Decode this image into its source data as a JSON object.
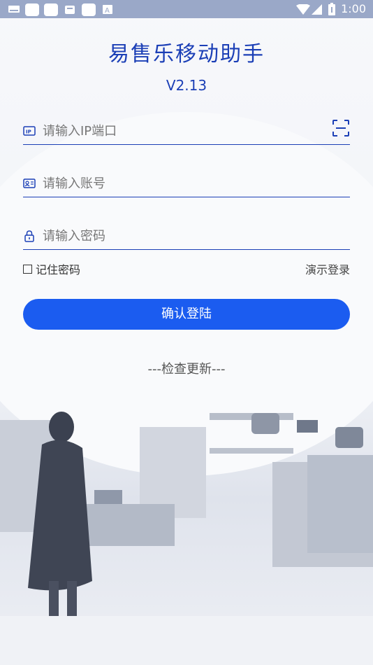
{
  "status_bar": {
    "time": "1:00",
    "icons": [
      "keyboard-icon",
      "app-icon",
      "app-icon",
      "app-icon",
      "app-icon",
      "font-icon",
      "wifi-icon",
      "signal-icon",
      "battery-icon"
    ]
  },
  "header": {
    "title": "易售乐移动助手",
    "version": "V2.13"
  },
  "form": {
    "ip_placeholder": "请输入IP端口",
    "ip_value": "",
    "account_placeholder": "请输入账号",
    "account_value": "",
    "password_placeholder": "请输入密码",
    "password_value": "",
    "remember_label": "记住密码",
    "remember_checked": false,
    "demo_login_label": "演示登录",
    "submit_label": "确认登陆"
  },
  "footer": {
    "check_update_label": "---检查更新---"
  },
  "colors": {
    "accent": "#1b3fb6",
    "button": "#1b5cf0",
    "status_bar": "#9aa8c8"
  }
}
